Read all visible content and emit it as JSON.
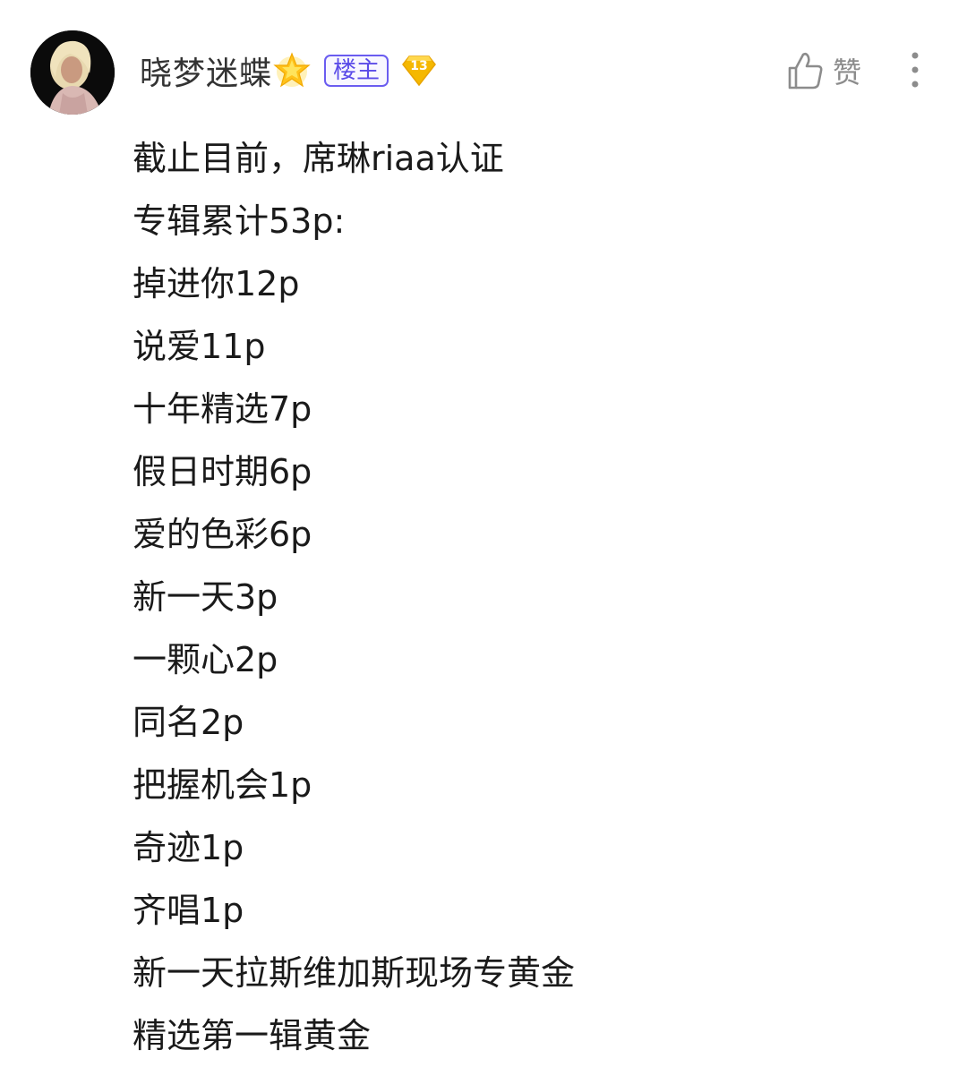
{
  "post": {
    "username": "晓梦迷蝶",
    "op_badge": "楼主",
    "level": "13",
    "like_label": "赞",
    "icons": {
      "avatar": "user-avatar-photo",
      "star": "glowing-star-emoji",
      "level": "diamond-level-icon",
      "like": "thumbs-up-icon",
      "more": "more-vertical-icon"
    },
    "lines": [
      "截止目前，席琳riaa认证",
      "专辑累计53p:",
      "掉进你12p",
      "说爱11p",
      "十年精选7p",
      "假日时期6p",
      "爱的色彩6p",
      "新一天3p",
      "一颗心2p",
      "同名2p",
      "把握机会1p",
      "奇迹1p",
      "齐唱1p",
      "新一天拉斯维加斯现场专黄金",
      "精选第一辑黄金"
    ]
  },
  "colors": {
    "op_badge": "#5b4ce8",
    "level_badge": "#f5b800",
    "icon_gray": "#8c8c8c"
  }
}
